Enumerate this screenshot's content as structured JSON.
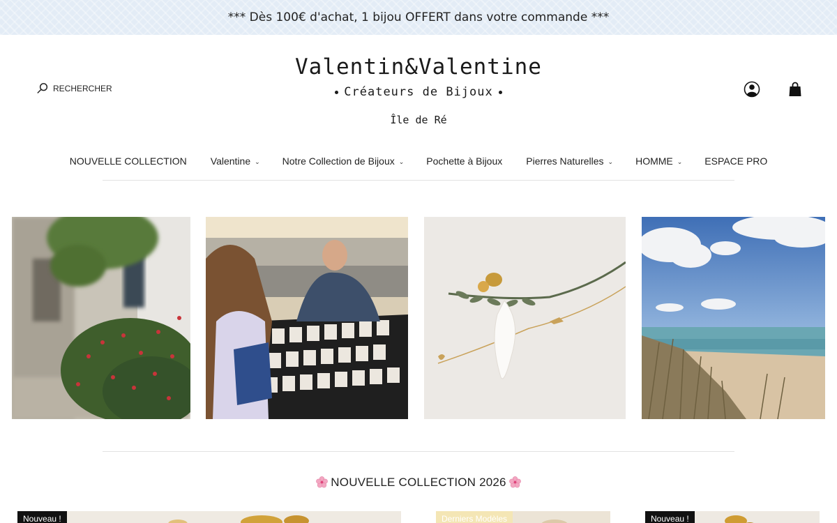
{
  "announcement": "*** Dès 100€ d'achat, 1 bijou OFFERT dans votre commande ***",
  "header": {
    "search_label": "RECHERCHER",
    "brand": "Valentin&Valentine",
    "tagline": "Créateurs de Bijoux",
    "location": "Île de Ré",
    "icons": [
      "account-icon",
      "cart-icon"
    ]
  },
  "nav": {
    "items": [
      {
        "label": "NOUVELLE COLLECTION",
        "has_dropdown": false
      },
      {
        "label": "Valentine",
        "has_dropdown": true
      },
      {
        "label": "Notre Collection de Bijoux",
        "has_dropdown": true
      },
      {
        "label": "Pochette à Bijoux",
        "has_dropdown": false
      },
      {
        "label": "Pierres Naturelles",
        "has_dropdown": true
      },
      {
        "label": "HOMME",
        "has_dropdown": true
      },
      {
        "label": "ESPACE PRO",
        "has_dropdown": false
      }
    ],
    "chevron": "⌄"
  },
  "collection": {
    "title": "NOUVELLE COLLECTION 2026",
    "cards": [
      {
        "badge": "Nouveau !"
      },
      {
        "badge": "Derniers Modèles"
      },
      {
        "badge": "Nouveau !"
      }
    ]
  },
  "colors": {
    "announcement_bg": "#e3ecf6",
    "text": "#222222",
    "badge_dark": "#111111",
    "badge_light": "#f4e6b5"
  }
}
